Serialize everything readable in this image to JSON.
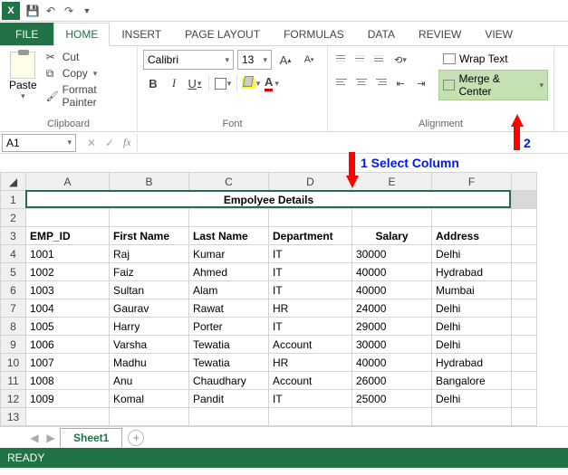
{
  "qat": {
    "app_letter": "X"
  },
  "tabs": {
    "file": "FILE",
    "home": "HOME",
    "insert": "INSERT",
    "page_layout": "PAGE LAYOUT",
    "formulas": "FORMULAS",
    "data": "DATA",
    "review": "REVIEW",
    "view": "VIEW"
  },
  "ribbon": {
    "clipboard": {
      "paste": "Paste",
      "cut": "Cut",
      "copy": "Copy",
      "format_painter": "Format Painter",
      "label": "Clipboard"
    },
    "font": {
      "name": "Calibri",
      "size": "13",
      "label": "Font"
    },
    "alignment": {
      "wrap": "Wrap Text",
      "merge": "Merge & Center",
      "label": "Alignment"
    }
  },
  "namebox": "A1",
  "annotations": {
    "sel": "1  Select Column",
    "merge": "2"
  },
  "columns": [
    "A",
    "B",
    "C",
    "D",
    "E",
    "F"
  ],
  "merged_title": "Empolyee Details",
  "headers": {
    "a": "EMP_ID",
    "b": "First Name",
    "c": "Last Name",
    "d": "Department",
    "e": "Salary",
    "f": "Address"
  },
  "rows": [
    {
      "id": "1001",
      "fn": "Raj",
      "ln": "Kumar",
      "dept": "IT",
      "sal": "30000",
      "addr": "Delhi"
    },
    {
      "id": "1002",
      "fn": "Faiz",
      "ln": "Ahmed",
      "dept": "IT",
      "sal": "40000",
      "addr": "Hydrabad"
    },
    {
      "id": "1003",
      "fn": "Sultan",
      "ln": "Alam",
      "dept": "IT",
      "sal": "40000",
      "addr": "Mumbai"
    },
    {
      "id": "1004",
      "fn": "Gaurav",
      "ln": "Rawat",
      "dept": "HR",
      "sal": "24000",
      "addr": "Delhi"
    },
    {
      "id": "1005",
      "fn": "Harry",
      "ln": "Porter",
      "dept": "IT",
      "sal": "29000",
      "addr": "Delhi"
    },
    {
      "id": "1006",
      "fn": "Varsha",
      "ln": "Tewatia",
      "dept": "Account",
      "sal": "30000",
      "addr": "Delhi"
    },
    {
      "id": "1007",
      "fn": "Madhu",
      "ln": "Tewatia",
      "dept": "HR",
      "sal": "40000",
      "addr": "Hydrabad"
    },
    {
      "id": "1008",
      "fn": "Anu",
      "ln": "Chaudhary",
      "dept": "Account",
      "sal": "26000",
      "addr": "Bangalore"
    },
    {
      "id": "1009",
      "fn": "Komal",
      "ln": "Pandit",
      "dept": "IT",
      "sal": "25000",
      "addr": "Delhi"
    }
  ],
  "sheet_tab": "Sheet1",
  "status": "READY"
}
